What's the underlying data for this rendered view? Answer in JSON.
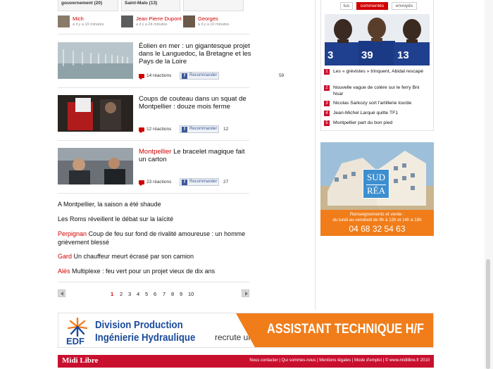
{
  "top_boxes": [
    "gouvernement (20)",
    "Saint-Malo (13)",
    ""
  ],
  "commenters": [
    {
      "name": "Mich",
      "time": "a il y a 10 minutes"
    },
    {
      "name": "Jean Pierre Dupont",
      "time": "a il y a 24 minutes"
    },
    {
      "name": "Georges",
      "time": "a il y a 10 minutes"
    }
  ],
  "stories": [
    {
      "kicker": "",
      "title": "Éolien en mer : un gigantesque projet dans le Languedoc, la Bretagne et les Pays de la Loire",
      "reactions": "14 réactions",
      "like_label": "Recommander",
      "likes": "59"
    },
    {
      "kicker": "",
      "title": "Coups de couteau dans un squat de Montpellier : douze mois ferme",
      "reactions": "12 réactions",
      "like_label": "Recommander",
      "likes": "12"
    },
    {
      "kicker": "Montpellier",
      "title": "Le bracelet magique fait un carton",
      "reactions": "23 réactions",
      "like_label": "Recommander",
      "likes": "27"
    }
  ],
  "briefs": [
    {
      "kicker": "",
      "text": "A Montpellier, la saison a été shaude"
    },
    {
      "kicker": "",
      "text": "Les Roms réveillent le débat sur la laïcité"
    },
    {
      "kicker": "Perpignan",
      "text": "Coup de feu sur fond de rivalité amoureuse : un homme grièvement blessé"
    },
    {
      "kicker": "Gard",
      "text": "Un chauffeur meurt écrasé par son camion"
    },
    {
      "kicker": "Alès",
      "text": "Multiplexe : feu vert pour un projet vieux de dix ans"
    }
  ],
  "pagination": {
    "current": "1",
    "pages": [
      "1",
      "2",
      "3",
      "4",
      "5",
      "6",
      "7",
      "8",
      "9",
      "10"
    ]
  },
  "sidebar": {
    "tabs": [
      "lus",
      "commentés",
      "envoyés"
    ],
    "active_tab": "commentés",
    "jersey_numbers": [
      "3",
      "39",
      "13"
    ],
    "most_commented": [
      {
        "rank": "1",
        "text": "Les « grévistes » trinquent, Abidal rescapé"
      },
      {
        "rank": "2",
        "text": "Nouvelle vague de colère sur le ferry Bni Nsar"
      },
      {
        "rank": "3",
        "text": "Nicolas Sarkozy sort l'artillerie lourde"
      },
      {
        "rank": "4",
        "text": "Jean-Michel Larqué quitte TF1"
      },
      {
        "rank": "5",
        "text": "Montpellier part du bon pied"
      }
    ]
  },
  "side_ad": {
    "brand_line1": "SUD",
    "brand_line2": "RÉA",
    "line1": "Renseignements et vente :",
    "line2": "du lundi au vendredi de 9h à 12h et 14h à 18h",
    "phone": "04 68 32 54 63"
  },
  "banner": {
    "brand": "EDF",
    "division1": "Division Production",
    "division2": "Ingénierie Hydraulique",
    "recruits": "recrute un",
    "job": "ASSISTANT TECHNIQUE H/F"
  },
  "footer": {
    "logo": "Midi Libre",
    "links": [
      "Nous contacter",
      "Qui sommes-nous",
      "Mentions légales",
      "Mode d'emploi",
      "© www.midilibre.fr 2010"
    ]
  },
  "colors": {
    "accent": "#d10000",
    "footer": "#c8102e",
    "ad_orange": "#f07d1a",
    "facebook": "#3b5998"
  }
}
